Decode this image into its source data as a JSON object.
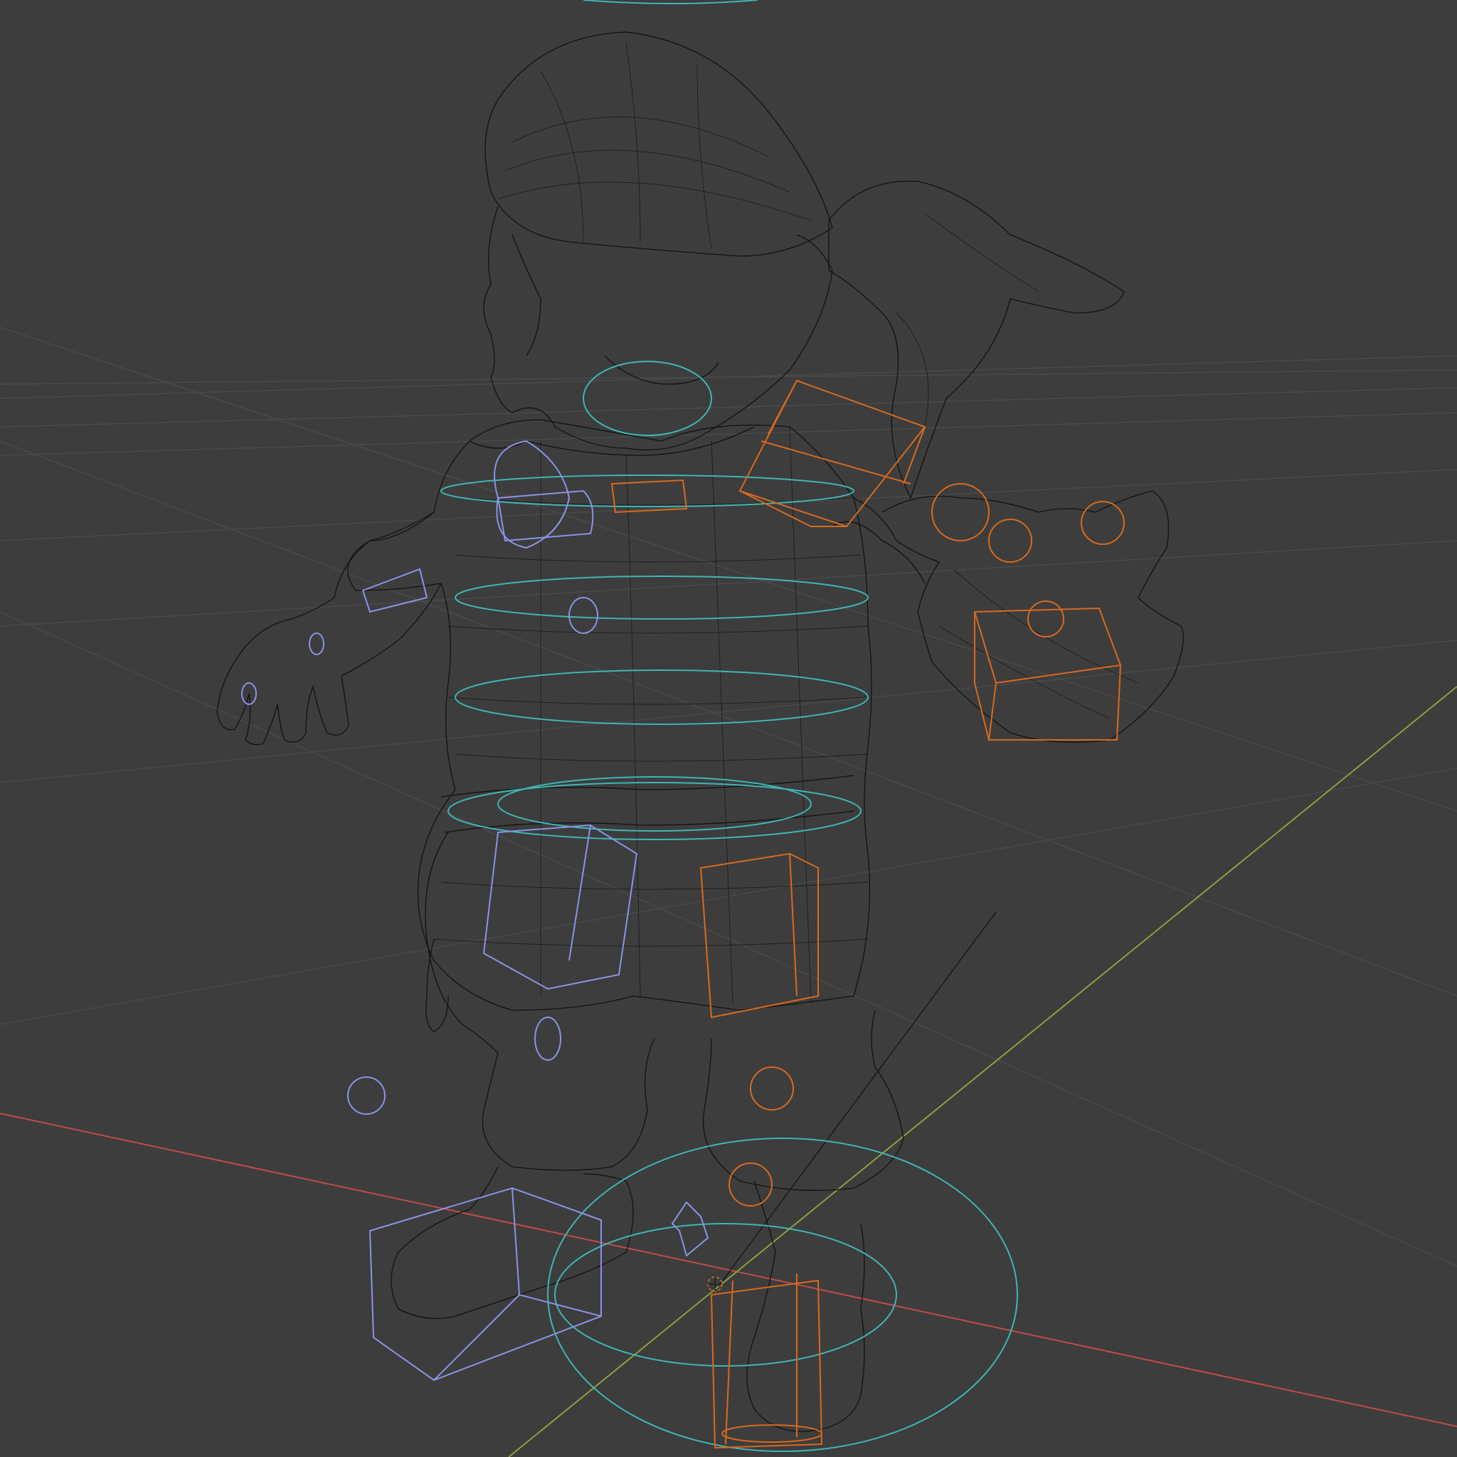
{
  "viewport": {
    "mode": "wireframe",
    "background_color": "#3d3d3d",
    "grid_color": "#4a4a4a",
    "axis_x_color": "#c24a4a",
    "axis_y_color": "#8aa13a",
    "mesh_color": "#121212",
    "object": "character-rig",
    "controls": {
      "cyan": "#3fb5b5",
      "orange": "#d8691e",
      "blue": "#8a93e6"
    }
  }
}
